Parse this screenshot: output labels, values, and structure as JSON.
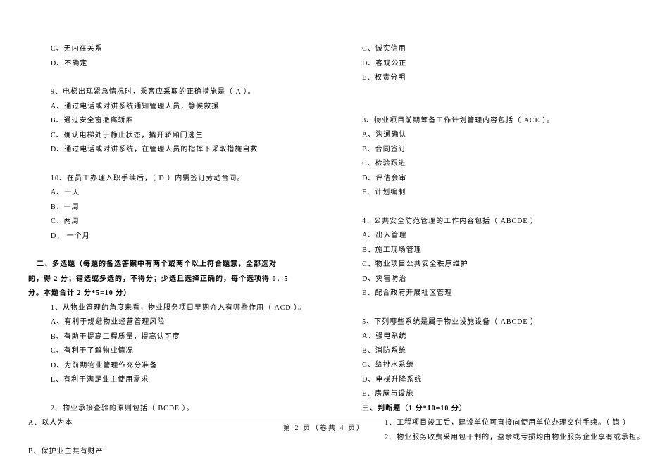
{
  "left": {
    "q8_c": "C、无内在关系",
    "q8_d": "D、不确定",
    "q9": "9、电梯出现紧急情况时，乘客应采取的正确措施是（  A   ）。",
    "q9_a": "A、通过电话或对讲系统通知管理人员，静候救援",
    "q9_b": "B、通过安全窗撤离轿厢",
    "q9_c": "C、确认电梯处于静止状态，撬开轿厢门逃生",
    "q9_d": "D、通过电话或对讲系统，在管理人员的指挥下采取措施自救",
    "q10": "10、在员工办理入职手续后，（  D   ）内需签订劳动合同。",
    "q10_a": "A、一天",
    "q10_b": "B、一周",
    "q10_c": "C、两周",
    "q10_d": "D、 一个月",
    "section2_l1": "二、多选题（每题的备选答案中有两个或两个以上符合题意，全部选对",
    "section2_l2": "的，得 2 分；错选或多选的，不得分；少选且选择正确的，每个选项得 0．5",
    "section2_l3": "分。本题合计 2 分*5=10 分）",
    "mq1": "1、从物业管理的角度来看，物业服务项目早期介入有哪些作用（  ACD     ）。",
    "mq1_a": "A、有利于规避物业经营管理风险",
    "mq1_b": "B、有助于提高工程质量，提高认可度",
    "mq1_c": "C、有利于了解物业情况",
    "mq1_d": "D、为前期物业管理作充分准备",
    "mq1_e": "E、有利于满足业主使用需求",
    "mq2": "2、物业承接查验的原则包括（ BCDE    ）。",
    "mq2_a": "A、以人为本",
    "mq2_b": "B、保护业主共有财产"
  },
  "right": {
    "mq2_c": "C、诚实信用",
    "mq2_d": "D、客观公正",
    "mq2_e": "E、权责分明",
    "mq3": "3、物业项目前期筹备工作计划管理内容包括（  ACE     ）。",
    "mq3_a": "A、沟通确认",
    "mq3_b": "B、合同签订",
    "mq3_c": "C、检验跟进",
    "mq3_d": "D、评估会审",
    "mq3_e": "E、计划编制",
    "mq4": "4、公共安全防范管理的工作内容包括（ ABCDE      ）",
    "mq4_a": "A、出入管理",
    "mq4_b": "B、施工现场管理",
    "mq4_c": "C、物业项目公共安全秩序维护",
    "mq4_d": "D、灾害防治",
    "mq4_e": "E、配合政府开展社区管理",
    "mq5": "5、下列哪些系统是属于物业设施设备（  ABCDE    ）",
    "mq5_a": "A、强电系统",
    "mq5_b": "B、消防系统",
    "mq5_c": "C、给排水系统",
    "mq5_d": "D、电梯升降系统",
    "mq5_e": "E、房屋与设施",
    "section3": "三、判断题（1 分*10=10 分）",
    "jq1": "1、工程项目竣工后，建设单位可直接向使用单位办理交付手续。（ 错    ）",
    "jq2": "2、物业服务收费采用包干制的，盈余或亏损均由物业服务企业享有或承担。"
  },
  "footer": "第  2  页（卷共 4 页）"
}
